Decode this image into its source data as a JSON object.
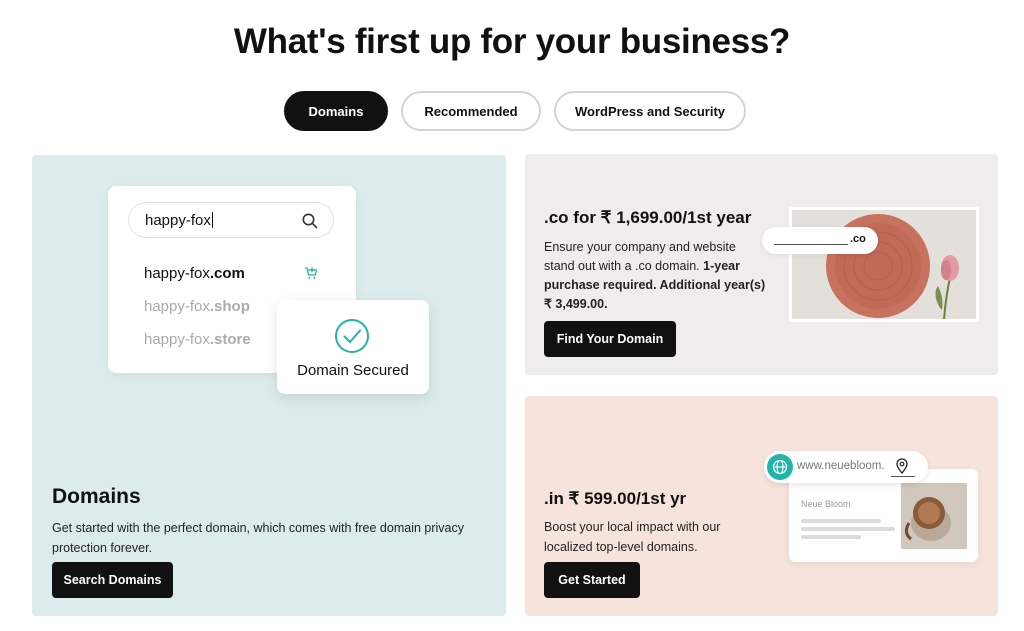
{
  "headline": "What's first up for your business?",
  "tabs": [
    {
      "label": "Domains",
      "active": true
    },
    {
      "label": "Recommended",
      "active": false
    },
    {
      "label": "WordPress and Security",
      "active": false
    }
  ],
  "domains_card": {
    "search": {
      "value": "happy-fox",
      "results": [
        {
          "name": "happy-fox",
          "tld": ".com",
          "available": true
        },
        {
          "name": "happy-fox",
          "tld": ".shop",
          "available": false
        },
        {
          "name": "happy-fox",
          "tld": ".store",
          "available": false
        }
      ]
    },
    "secured_label": "Domain Secured",
    "title": "Domains",
    "description": "Get started with the perfect domain, which comes with free domain privacy protection forever.",
    "button": "Search Domains"
  },
  "co_card": {
    "title": ".co for ₹ 1,699.00/1st year",
    "description_plain": "Ensure your company and website stand out with a .co domain. ",
    "description_bold": "1-year purchase required. Additional year(s) ₹ 3,499.00.",
    "button": "Find Your Domain",
    "url_tld": ".co"
  },
  "in_card": {
    "title": ".in ₹ 599.00/1st yr",
    "description": "Boost your local impact with our localized top-level domains.",
    "button": "Get Started",
    "url_text": "www.neuebloom.",
    "site_name": "Neue Bloom"
  },
  "colors": {
    "domains_bg": "#dcebeb",
    "co_bg": "#efedeb",
    "in_bg": "#f6e4dc",
    "accent_teal": "#1fb5a8",
    "button_bg": "#111111"
  }
}
